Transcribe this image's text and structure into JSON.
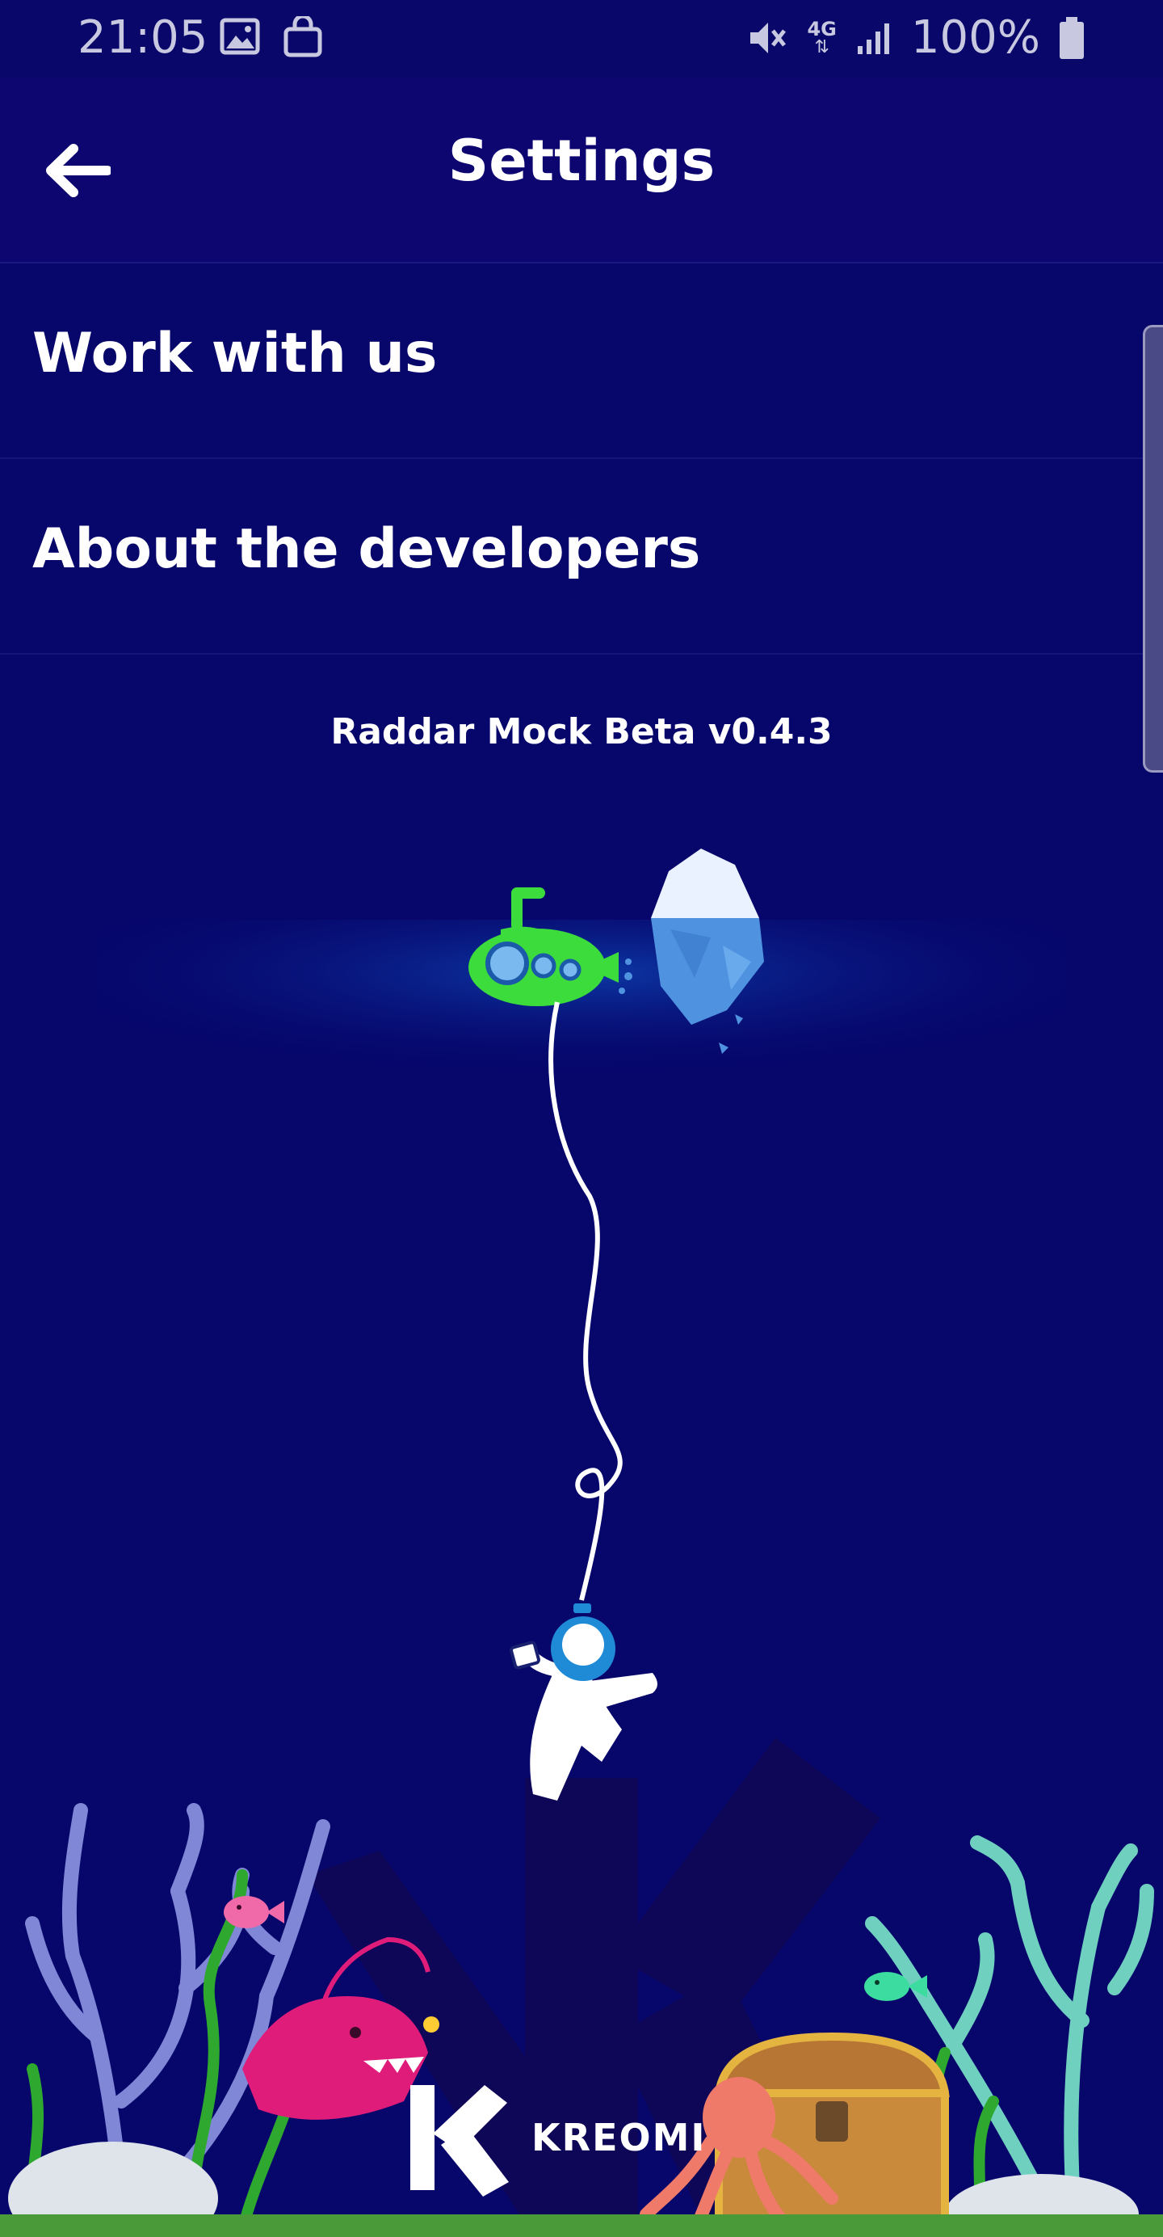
{
  "status_bar": {
    "time": "21:05",
    "network": "4G",
    "battery": "100%"
  },
  "app_bar": {
    "title": "Settings"
  },
  "menu": {
    "items": [
      {
        "label": "Work with us"
      },
      {
        "label": "About the developers"
      }
    ]
  },
  "version": "Raddar Mock Beta v0.4.3",
  "brand": {
    "name": "KREOMI"
  },
  "colors": {
    "background": "#06066b",
    "app_bar": "#0d0670",
    "submarine": "#3cdc3c",
    "anglerfish": "#e01c7a",
    "diver_helmet": "#1f8ad6"
  }
}
